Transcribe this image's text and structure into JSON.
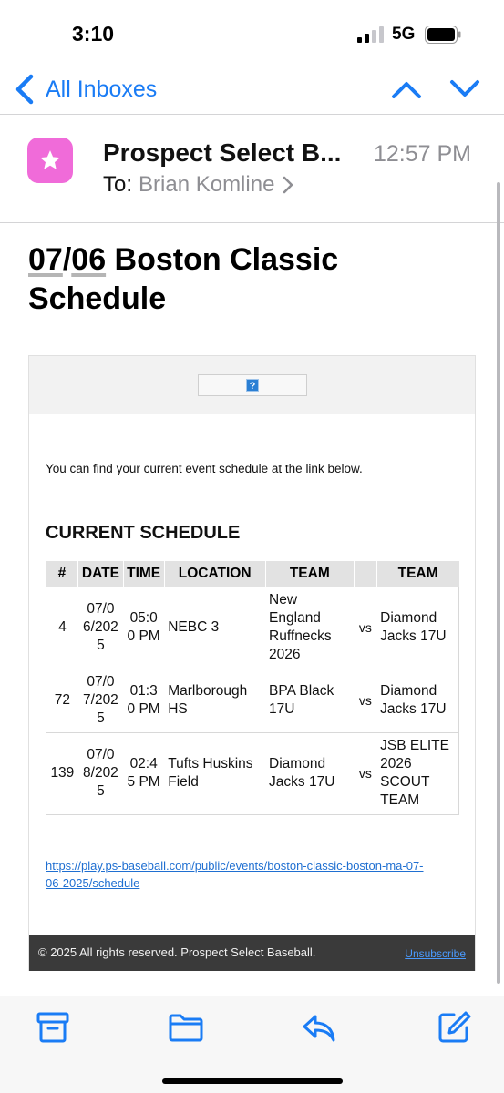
{
  "status_bar": {
    "time": "3:10",
    "network": "5G"
  },
  "nav": {
    "back_label": "All Inboxes"
  },
  "message": {
    "sender": "Prospect Select B...",
    "time": "12:57 PM",
    "to_prefix": "To:",
    "recipient": "Brian Komline",
    "subject_part1": "07",
    "subject_sep": "/",
    "subject_part2": "06",
    "subject_rest": " Boston Classic Schedule"
  },
  "body": {
    "intro": "You can find your current event schedule at the link below.",
    "schedule_heading": "CURRENT SCHEDULE",
    "table": {
      "headers": [
        "#",
        "DATE",
        "TIME",
        "LOCATION",
        "TEAM",
        "",
        "TEAM"
      ],
      "rows": [
        {
          "num": "4",
          "date": "07/06/2025",
          "time": "05:00 PM",
          "location": "NEBC 3",
          "team1": "New England Ruffnecks 2026",
          "vs": "vs",
          "team2": "Diamond Jacks 17U"
        },
        {
          "num": "72",
          "date": "07/07/2025",
          "time": "01:30 PM",
          "location": "Marlborough HS",
          "team1": "BPA Black 17U",
          "vs": "vs",
          "team2": "Diamond Jacks 17U"
        },
        {
          "num": "139",
          "date": "07/08/2025",
          "time": "02:45 PM",
          "location": "Tufts Huskins Field",
          "team1": "Diamond Jacks 17U",
          "vs": "vs",
          "team2": "JSB ELITE 2026 SCOUT TEAM"
        }
      ]
    },
    "link": "https://play.ps-baseball.com/public/events/boston-classic-boston-ma-07-06-2025/schedule",
    "footer": {
      "copyright": "© 2025 All rights reserved. Prospect Select Baseball.",
      "unsubscribe": "Unsubscribe"
    }
  },
  "colors": {
    "accent": "#1a7cf5",
    "avatar": "#f06bd9",
    "footer_bg": "#3a3a3a"
  },
  "icons": [
    "signal-icon",
    "battery-icon",
    "back-chevron-icon",
    "chevron-up-icon",
    "chevron-down-icon",
    "star-icon",
    "archive-icon",
    "folder-icon",
    "reply-icon",
    "compose-icon"
  ]
}
